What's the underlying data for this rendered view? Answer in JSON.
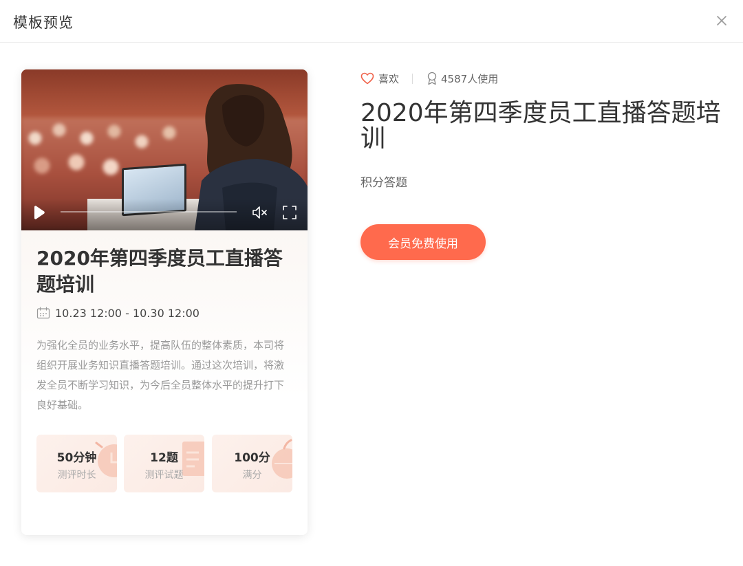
{
  "header": {
    "title": "模板预览"
  },
  "card": {
    "title": "2020年第四季度员工直播答题培训",
    "date_range": "10.23 12:00 - 10.30 12:00",
    "description": "为强化全员的业务水平，提高队伍的整体素质，本司将组织开展业务知识直播答题培训。通过这次培训，将激发全员不断学习知识，为今后全员整体水平的提升打下良好基础。",
    "video": {
      "progress_fraction": 0.0
    },
    "stats": [
      {
        "value": "50分钟",
        "label": "测评时长"
      },
      {
        "value": "12题",
        "label": "测评试题"
      },
      {
        "value": "100分",
        "label": "满分"
      }
    ]
  },
  "detail": {
    "like_label": "喜欢",
    "usage_count": "4587人使用",
    "title": "2020年第四季度员工直播答题培训",
    "category": "积分答题",
    "cta_label": "会员免费使用"
  },
  "colors": {
    "accent": "#ff6a4d",
    "heart": "#f0624a"
  },
  "icons": [
    "close-icon",
    "play-icon",
    "mute-icon",
    "fullscreen-icon",
    "calendar-icon",
    "heart-icon",
    "medal-icon"
  ]
}
